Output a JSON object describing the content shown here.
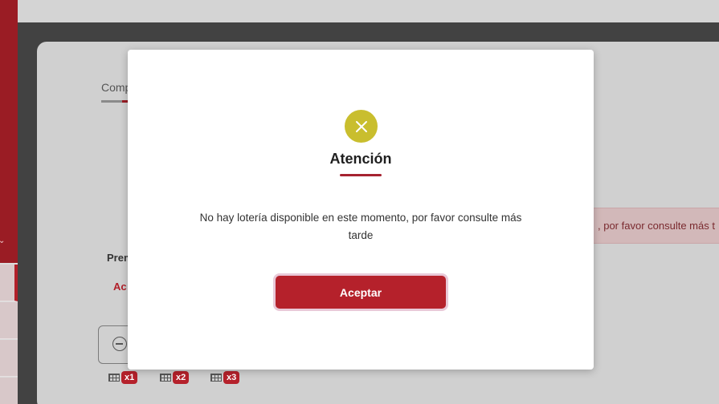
{
  "background": {
    "tab_label": "Comp",
    "section_label": "Prem",
    "action_label": "Ac",
    "multipliers": [
      "x1",
      "x2",
      "x3"
    ],
    "alert_text": ", por favor consulte más t"
  },
  "modal": {
    "icon": "close-icon",
    "title": "Atención",
    "message_line1": "No hay lotería disponible en este momento, por favor consulte más",
    "message_line2": "tarde",
    "accept_label": "Aceptar"
  },
  "colors": {
    "brand_red": "#b5212b",
    "icon_yellow": "#c9be2e",
    "sidebar_red": "#9a1c24"
  }
}
